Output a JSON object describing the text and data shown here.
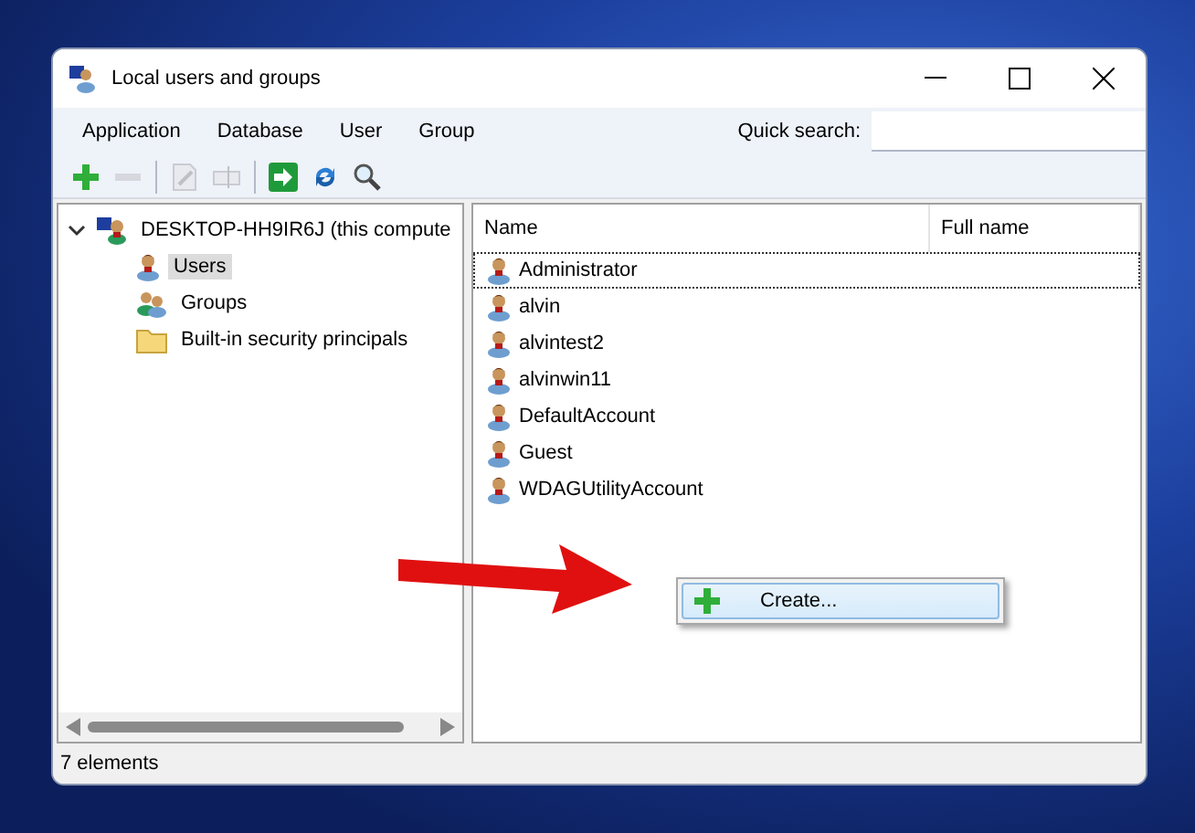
{
  "window": {
    "title": "Local users and groups"
  },
  "menu": [
    {
      "label": "Application"
    },
    {
      "label": "Database"
    },
    {
      "label": "User"
    },
    {
      "label": "Group"
    }
  ],
  "search": {
    "label": "Quick search:"
  },
  "toolbar": [
    {
      "kind": "add",
      "disabled": false
    },
    {
      "kind": "remove",
      "disabled": true
    },
    {
      "kind": "separator"
    },
    {
      "kind": "edit",
      "disabled": true
    },
    {
      "kind": "rename",
      "disabled": true
    },
    {
      "kind": "separator"
    },
    {
      "kind": "go",
      "disabled": false
    },
    {
      "kind": "refresh",
      "disabled": false
    },
    {
      "kind": "find",
      "disabled": false
    }
  ],
  "tree": [
    {
      "label": "DESKTOP-HH9IR6J (this compute",
      "kind": "computer",
      "expanded": true,
      "selected": false,
      "children": [
        {
          "label": "Users",
          "kind": "users",
          "selected": true
        },
        {
          "label": "Groups",
          "kind": "groups",
          "selected": false
        },
        {
          "label": "Built-in security principals",
          "kind": "folder",
          "selected": false
        }
      ]
    }
  ],
  "table": {
    "columns": [
      "Name",
      "Full name"
    ],
    "rows": [
      {
        "name": "Administrator",
        "focused": true
      },
      {
        "name": "alvin",
        "focused": false
      },
      {
        "name": "alvintest2",
        "focused": false
      },
      {
        "name": "alvinwin11",
        "focused": false
      },
      {
        "name": "DefaultAccount",
        "focused": false
      },
      {
        "name": "Guest",
        "focused": false
      },
      {
        "name": "WDAGUtilityAccount",
        "focused": false
      }
    ]
  },
  "context_menu": {
    "items": [
      {
        "label": "Create..."
      }
    ]
  },
  "status_bar": "7 elements"
}
